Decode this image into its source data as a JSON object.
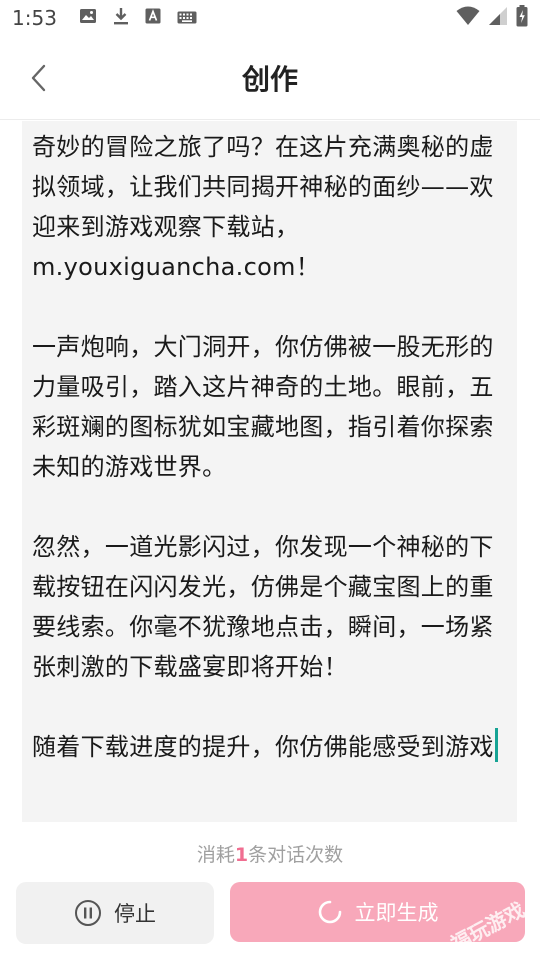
{
  "status_bar": {
    "time": "1:53",
    "icons_left": [
      "image-icon",
      "download-icon",
      "font-icon",
      "keyboard-icon"
    ],
    "icons_right": [
      "wifi-icon",
      "signal-icon",
      "battery-icon"
    ]
  },
  "header": {
    "title": "创作",
    "back_icon": "chevron-left-icon"
  },
  "content": {
    "paragraphs": [
      "奇妙的冒险之旅了吗？在这片充满奥秘的虚拟领域，让我们共同揭开神秘的面纱——欢迎来到游戏观察下载站，m.youxiguancha.com！",
      "一声炮响，大门洞开，你仿佛被一股无形的力量吸引，踏入这片神奇的土地。眼前，五彩斑斓的图标犹如宝藏地图，指引着你探索未知的游戏世界。",
      "忽然，一道光影闪过，你发现一个神秘的下载按钮在闪闪发光，仿佛是个藏宝图上的重要线索。你毫不犹豫地点击，瞬间，一场紧张刺激的下载盛宴即将开始！",
      "随着下载进度的提升，你仿佛能感受到游戏"
    ]
  },
  "usage": {
    "prefix": "消耗",
    "count": "1",
    "suffix": "条对话次数"
  },
  "buttons": {
    "stop_label": "停止",
    "generate_label": "立即生成"
  },
  "watermark": "福玩游戏",
  "colors": {
    "accent_pink": "#f06e91",
    "generate_bg": "#f8a8ba",
    "caret": "#16a394"
  }
}
